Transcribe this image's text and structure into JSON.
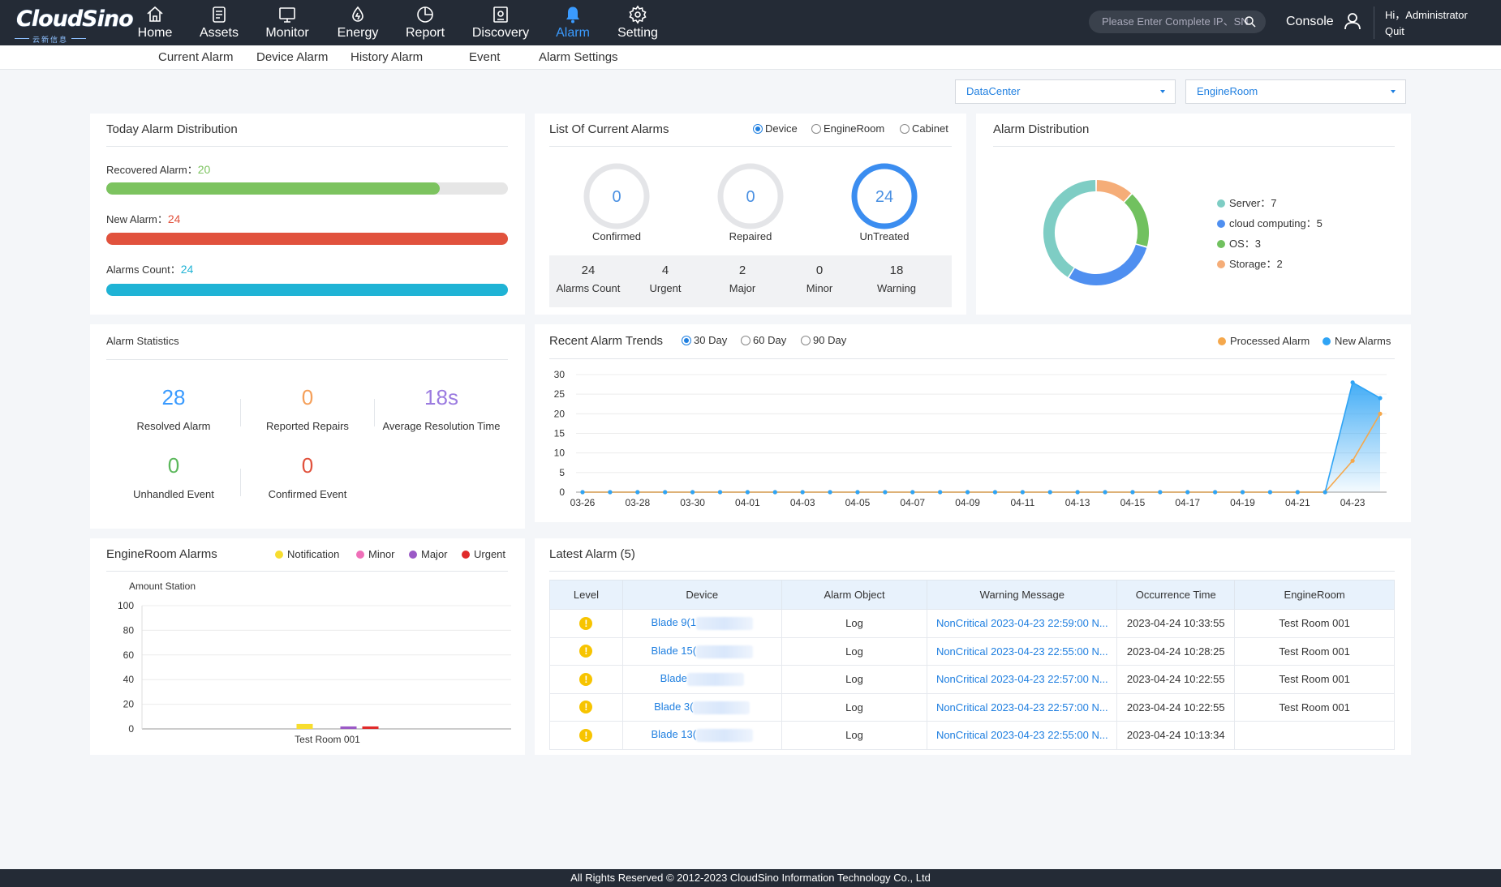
{
  "brand": {
    "logo_text": "CloudSino",
    "logo_sub": "云新信息"
  },
  "nav": [
    {
      "label": "Home",
      "icon": "home-icon"
    },
    {
      "label": "Assets",
      "icon": "assets-icon"
    },
    {
      "label": "Monitor",
      "icon": "monitor-icon"
    },
    {
      "label": "Energy",
      "icon": "energy-icon"
    },
    {
      "label": "Report",
      "icon": "report-icon"
    },
    {
      "label": "Discovery",
      "icon": "discovery-icon"
    },
    {
      "label": "Alarm",
      "icon": "bell-icon",
      "active": true
    },
    {
      "label": "Setting",
      "icon": "gear-icon"
    }
  ],
  "header": {
    "search_placeholder": "Please Enter Complete IP、SN",
    "console": "Console",
    "greeting": "Hi，Administrator",
    "quit": "Quit"
  },
  "subnav": [
    "Current Alarm",
    "Device Alarm",
    "History Alarm",
    "Event",
    "Alarm Settings"
  ],
  "filters": {
    "datacenter": "DataCenter",
    "engineroom": "EngineRoom"
  },
  "today": {
    "title": "Today Alarm Distribution",
    "rows": [
      {
        "label": "Recovered Alarm：",
        "value": "20",
        "color": "#7cc35f",
        "fraction": 0.83
      },
      {
        "label": "New Alarm：",
        "value": "24",
        "color": "#e1523d",
        "fraction": 1.0
      },
      {
        "label": "Alarms Count：",
        "value": "24",
        "color": "#1fb3d5",
        "fraction": 1.0
      }
    ]
  },
  "current": {
    "title": "List Of Current Alarms",
    "radios": [
      {
        "label": "Device",
        "on": true
      },
      {
        "label": "EngineRoom",
        "on": false
      },
      {
        "label": "Cabinet",
        "on": false
      }
    ],
    "rings": [
      {
        "value": "0",
        "label": "Confirmed"
      },
      {
        "value": "0",
        "label": "Repaired"
      },
      {
        "value": "24",
        "label": "UnTreated"
      }
    ],
    "counts": [
      {
        "n": "24",
        "t": "Alarms Count"
      },
      {
        "n": "4",
        "t": "Urgent"
      },
      {
        "n": "2",
        "t": "Major"
      },
      {
        "n": "0",
        "t": "Minor"
      },
      {
        "n": "18",
        "t": "Warning"
      }
    ]
  },
  "distribution": {
    "title": "Alarm Distribution",
    "items": [
      {
        "label": "Server：",
        "value": "7",
        "color": "#7ecdc4"
      },
      {
        "label": "cloud computing：",
        "value": "5",
        "color": "#4f8ff0"
      },
      {
        "label": "OS：",
        "value": "3",
        "color": "#71c15f"
      },
      {
        "label": "Storage：",
        "value": "2",
        "color": "#f5ad78"
      }
    ]
  },
  "statistics": {
    "title": "Alarm Statistics",
    "items": [
      {
        "value": "28",
        "label": "Resolved Alarm",
        "color": "#3a9bff"
      },
      {
        "value": "0",
        "label": "Reported Repairs",
        "color": "#f5a05a"
      },
      {
        "value": "18s",
        "label": "Average Resolution Time",
        "color": "#9b7be0"
      },
      {
        "value": "0",
        "label": "Unhandled Event",
        "color": "#5cb85c"
      },
      {
        "value": "0",
        "label": "Confirmed Event",
        "color": "#e1523d"
      }
    ]
  },
  "trends": {
    "title": "Recent Alarm Trends",
    "radios": [
      {
        "label": "30 Day",
        "on": true
      },
      {
        "label": "60 Day",
        "on": false
      },
      {
        "label": "90 Day",
        "on": false
      }
    ],
    "legend": [
      {
        "label": "Processed Alarm",
        "color": "#f5a84c"
      },
      {
        "label": "New Alarms",
        "color": "#2fa4f5"
      }
    ]
  },
  "engineroom": {
    "title": "EngineRoom Alarms",
    "ylabel": "Amount Station",
    "legend": [
      {
        "label": "Notification",
        "color": "#f7dd2f"
      },
      {
        "label": "Minor",
        "color": "#ef6fb8"
      },
      {
        "label": "Major",
        "color": "#9b59c6"
      },
      {
        "label": "Urgent",
        "color": "#e02a2a"
      }
    ]
  },
  "latest": {
    "title": "Latest Alarm (5)",
    "columns": [
      "Level",
      "Device",
      "Alarm Object",
      "Warning Message",
      "Occurrence Time",
      "EngineRoom"
    ],
    "rows": [
      {
        "device": "Blade 9(1",
        "object": "Log",
        "message": "NonCritical 2023-04-23 22:59:00 N...",
        "time": "2023-04-24 10:33:55",
        "room": "Test Room 001"
      },
      {
        "device": "Blade 15(",
        "object": "Log",
        "message": "NonCritical 2023-04-23 22:55:00 N...",
        "time": "2023-04-24 10:28:25",
        "room": "Test Room 001"
      },
      {
        "device": "Blade",
        "object": "Log",
        "message": "NonCritical 2023-04-23 22:57:00 N...",
        "time": "2023-04-24 10:22:55",
        "room": "Test Room 001"
      },
      {
        "device": "Blade 3(",
        "object": "Log",
        "message": "NonCritical 2023-04-23 22:57:00 N...",
        "time": "2023-04-24 10:22:55",
        "room": "Test Room 001"
      },
      {
        "device": "Blade 13(",
        "object": "Log",
        "message": "NonCritical 2023-04-23 22:55:00 N...",
        "time": "2023-04-24 10:13:34",
        "room": ""
      }
    ]
  },
  "footer": "All Rights Reserved © 2012-2023  CloudSino Information Technology Co., Ltd",
  "chart_data": [
    {
      "type": "line",
      "title": "Recent Alarm Trends",
      "x": [
        "03-26",
        "03-27",
        "03-28",
        "03-29",
        "03-30",
        "03-31",
        "04-01",
        "04-02",
        "04-03",
        "04-04",
        "04-05",
        "04-06",
        "04-07",
        "04-08",
        "04-09",
        "04-10",
        "04-11",
        "04-12",
        "04-13",
        "04-14",
        "04-15",
        "04-16",
        "04-17",
        "04-18",
        "04-19",
        "04-20",
        "04-21",
        "04-22",
        "04-23",
        "04-24"
      ],
      "xticks": [
        "03-26",
        "03-28",
        "03-30",
        "04-01",
        "04-03",
        "04-05",
        "04-07",
        "04-09",
        "04-11",
        "04-13",
        "04-15",
        "04-17",
        "04-19",
        "04-21",
        "04-23"
      ],
      "series": [
        {
          "name": "New Alarms",
          "color": "#2fa4f5",
          "values": [
            0,
            0,
            0,
            0,
            0,
            0,
            0,
            0,
            0,
            0,
            0,
            0,
            0,
            0,
            0,
            0,
            0,
            0,
            0,
            0,
            0,
            0,
            0,
            0,
            0,
            0,
            0,
            0,
            28,
            24
          ]
        },
        {
          "name": "Processed Alarm",
          "color": "#f5a84c",
          "values": [
            0,
            0,
            0,
            0,
            0,
            0,
            0,
            0,
            0,
            0,
            0,
            0,
            0,
            0,
            0,
            0,
            0,
            0,
            0,
            0,
            0,
            0,
            0,
            0,
            0,
            0,
            0,
            0,
            8,
            20
          ]
        }
      ],
      "ylim": [
        0,
        30
      ],
      "yticks": [
        0,
        5,
        10,
        15,
        20,
        25,
        30
      ]
    },
    {
      "type": "bar",
      "title": "EngineRoom Alarms",
      "categories": [
        "Test Room 001"
      ],
      "series": [
        {
          "name": "Notification",
          "color": "#f7dd2f",
          "values": [
            4
          ]
        },
        {
          "name": "Minor",
          "color": "#ef6fb8",
          "values": [
            0
          ]
        },
        {
          "name": "Major",
          "color": "#9b59c6",
          "values": [
            2
          ]
        },
        {
          "name": "Urgent",
          "color": "#e02a2a",
          "values": [
            2
          ]
        }
      ],
      "ylim": [
        0,
        100
      ],
      "yticks": [
        0,
        20,
        40,
        60,
        80,
        100
      ]
    },
    {
      "type": "pie",
      "title": "Alarm Distribution",
      "categories": [
        "Server",
        "cloud computing",
        "OS",
        "Storage"
      ],
      "values": [
        7,
        5,
        3,
        2
      ]
    }
  ]
}
